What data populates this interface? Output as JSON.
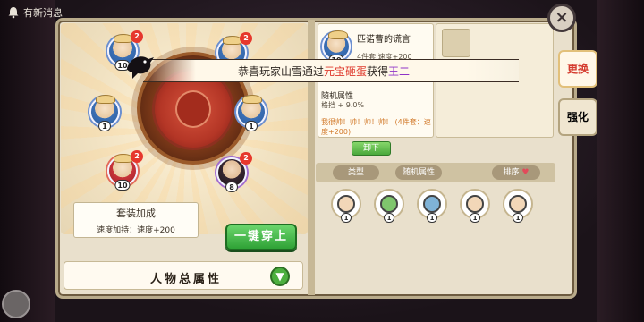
{
  "notification": {
    "text": "有新消息"
  },
  "left": {
    "heroes": [
      {
        "level": "10",
        "up": "2"
      },
      {
        "level": "",
        "up": "2"
      },
      {
        "level": "1",
        "up": ""
      },
      {
        "level": "1",
        "up": ""
      },
      {
        "level": "10",
        "up": "2"
      },
      {
        "level": "8",
        "up": "2"
      }
    ],
    "set_bonus": {
      "title": "套装加成",
      "desc": "速度加持：速度+200"
    },
    "equip_all_button": "一键穿上",
    "attributes_bar": "人物总属性"
  },
  "item": {
    "name": "匹诺曹的谎言",
    "subtitle": "4件套  速度+200",
    "thumb_level": "10",
    "random_attr_title": "随机属性",
    "random_attr_value": "格挡 + 9.0%",
    "set_text": "我很帅！帅！帅！帅！ (4件套：速度+200)",
    "unequip_button": "卸下"
  },
  "filters": {
    "type": "类型",
    "random": "随机属性",
    "sort": "排序",
    "sort_icon": "♥"
  },
  "inventory_levels": [
    "1",
    "1",
    "1",
    "1",
    "1"
  ],
  "side_tabs": {
    "replace": "更换",
    "enhance": "强化"
  },
  "banner": {
    "prefix": "恭喜玩家山雪通过",
    "source": "元宝砸蛋",
    "middle": "获得",
    "reward": "王二"
  },
  "colors": {
    "accent_red": "#df3a2d",
    "reward_purple": "#8f33c7",
    "confirm_green": "#2fa236"
  }
}
